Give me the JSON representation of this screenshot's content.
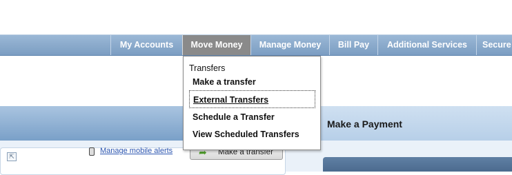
{
  "nav": {
    "items": [
      {
        "label": "My Accounts"
      },
      {
        "label": "Move Money"
      },
      {
        "label": "Manage Money"
      },
      {
        "label": "Bill Pay"
      },
      {
        "label": "Additional Services"
      },
      {
        "label": "Secure"
      }
    ],
    "active_index": 1
  },
  "dropdown": {
    "header": "Transfers",
    "items": [
      {
        "label": "Make a transfer"
      },
      {
        "label": "External Transfers"
      },
      {
        "label": "Schedule a Transfer"
      },
      {
        "label": "View Scheduled Transfers"
      }
    ]
  },
  "right_panel": {
    "title": "Make a Payment"
  },
  "left_panel": {
    "mobile_alerts_link": "Manage mobile alerts",
    "make_transfer_button": "Make a transfer"
  },
  "icons": {
    "collapse": "collapse-icon",
    "phone": "mobile-phone-icon",
    "transfer": "transfer-arrow-icon"
  },
  "colors": {
    "nav_bg": "#7b9dc2",
    "nav_active": "#8a8a8a",
    "link": "#2b55b0"
  }
}
